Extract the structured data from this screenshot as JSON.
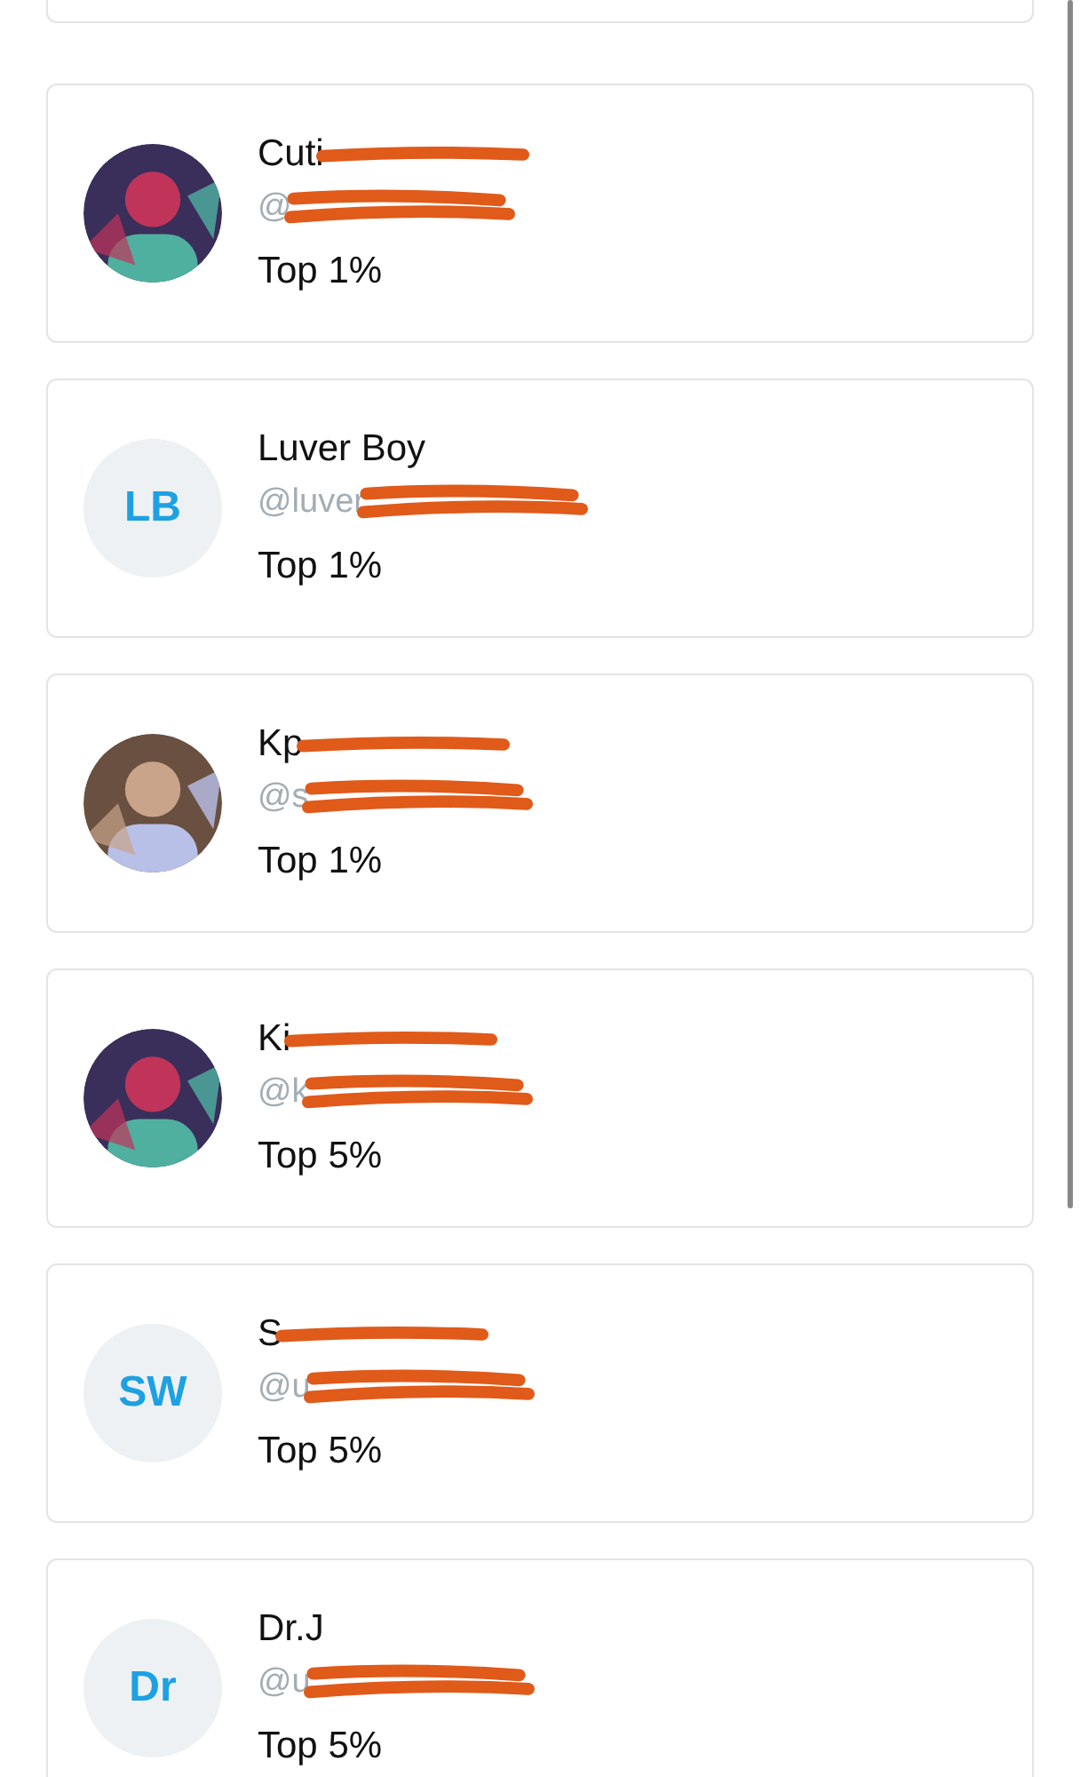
{
  "fans": [
    {
      "name": "Cuti",
      "name_redacted": true,
      "handle": "@",
      "handle_redacted": true,
      "rank": "Top 1%"
    },
    {
      "avatar": {
        "kind": "initials",
        "text": "LB"
      },
      "name": "Luver Boy",
      "name_redacted": false,
      "handle": "@luver",
      "handle_redacted": true,
      "rank": "Top 1%"
    },
    {
      "name": "Kp",
      "name_redacted": true,
      "handle": "@s",
      "handle_redacted": true,
      "rank": "Top 1%"
    },
    {
      "name": "Ki",
      "name_redacted": true,
      "handle": "@k",
      "handle_redacted": true,
      "rank": "Top 5%"
    },
    {
      "avatar": {
        "kind": "initials",
        "text": "SW"
      },
      "name": "S",
      "name_redacted": true,
      "handle": "@u",
      "handle_redacted": true,
      "rank": "Top 5%"
    },
    {
      "avatar": {
        "kind": "initials",
        "text": "Dr"
      },
      "name": "Dr.J",
      "name_redacted": false,
      "handle": "@u",
      "handle_redacted": true,
      "rank": "Top 5%"
    }
  ]
}
